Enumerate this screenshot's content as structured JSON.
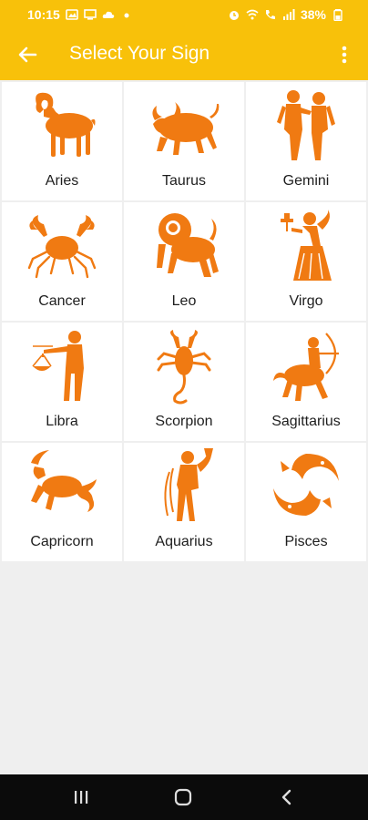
{
  "status_bar": {
    "time": "10:15",
    "battery": "38%",
    "left_icons": [
      "gallery-icon",
      "screen-icon",
      "cloud-icon",
      "dot-icon"
    ],
    "right_icons": [
      "alarm-icon",
      "wifi-icon",
      "call-icon",
      "signal-icon",
      "battery-icon"
    ]
  },
  "app_bar": {
    "title": "Select Your Sign",
    "back_icon": "arrow-left-icon",
    "menu_icon": "more-vertical-icon"
  },
  "colors": {
    "accent": "#f8c10a",
    "sign_orange": "#f07a12",
    "text": "#1e1e1e"
  },
  "signs": [
    {
      "label": "Aries",
      "icon": "aries-icon"
    },
    {
      "label": "Taurus",
      "icon": "taurus-icon"
    },
    {
      "label": "Gemini",
      "icon": "gemini-icon"
    },
    {
      "label": "Cancer",
      "icon": "cancer-icon"
    },
    {
      "label": "Leo",
      "icon": "leo-icon"
    },
    {
      "label": "Virgo",
      "icon": "virgo-icon"
    },
    {
      "label": "Libra",
      "icon": "libra-icon"
    },
    {
      "label": "Scorpion",
      "icon": "scorpion-icon"
    },
    {
      "label": "Sagittarius",
      "icon": "sagittarius-icon"
    },
    {
      "label": "Capricorn",
      "icon": "capricorn-icon"
    },
    {
      "label": "Aquarius",
      "icon": "aquarius-icon"
    },
    {
      "label": "Pisces",
      "icon": "pisces-icon"
    }
  ],
  "nav_bar": {
    "recents_icon": "recents-icon",
    "home_icon": "home-icon",
    "back_icon": "nav-back-icon"
  }
}
